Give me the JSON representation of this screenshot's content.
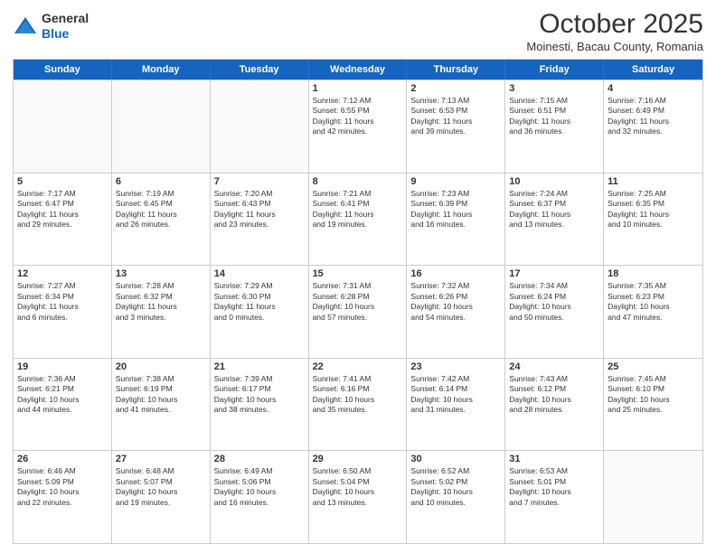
{
  "header": {
    "logo_general": "General",
    "logo_blue": "Blue",
    "month_title": "October 2025",
    "subtitle": "Moinesti, Bacau County, Romania"
  },
  "days_of_week": [
    "Sunday",
    "Monday",
    "Tuesday",
    "Wednesday",
    "Thursday",
    "Friday",
    "Saturday"
  ],
  "weeks": [
    [
      {
        "day": "",
        "info": ""
      },
      {
        "day": "",
        "info": ""
      },
      {
        "day": "",
        "info": ""
      },
      {
        "day": "1",
        "info": "Sunrise: 7:12 AM\nSunset: 6:55 PM\nDaylight: 11 hours\nand 42 minutes."
      },
      {
        "day": "2",
        "info": "Sunrise: 7:13 AM\nSunset: 6:53 PM\nDaylight: 11 hours\nand 39 minutes."
      },
      {
        "day": "3",
        "info": "Sunrise: 7:15 AM\nSunset: 6:51 PM\nDaylight: 11 hours\nand 36 minutes."
      },
      {
        "day": "4",
        "info": "Sunrise: 7:16 AM\nSunset: 6:49 PM\nDaylight: 11 hours\nand 32 minutes."
      }
    ],
    [
      {
        "day": "5",
        "info": "Sunrise: 7:17 AM\nSunset: 6:47 PM\nDaylight: 11 hours\nand 29 minutes."
      },
      {
        "day": "6",
        "info": "Sunrise: 7:19 AM\nSunset: 6:45 PM\nDaylight: 11 hours\nand 26 minutes."
      },
      {
        "day": "7",
        "info": "Sunrise: 7:20 AM\nSunset: 6:43 PM\nDaylight: 11 hours\nand 23 minutes."
      },
      {
        "day": "8",
        "info": "Sunrise: 7:21 AM\nSunset: 6:41 PM\nDaylight: 11 hours\nand 19 minutes."
      },
      {
        "day": "9",
        "info": "Sunrise: 7:23 AM\nSunset: 6:39 PM\nDaylight: 11 hours\nand 16 minutes."
      },
      {
        "day": "10",
        "info": "Sunrise: 7:24 AM\nSunset: 6:37 PM\nDaylight: 11 hours\nand 13 minutes."
      },
      {
        "day": "11",
        "info": "Sunrise: 7:25 AM\nSunset: 6:35 PM\nDaylight: 11 hours\nand 10 minutes."
      }
    ],
    [
      {
        "day": "12",
        "info": "Sunrise: 7:27 AM\nSunset: 6:34 PM\nDaylight: 11 hours\nand 6 minutes."
      },
      {
        "day": "13",
        "info": "Sunrise: 7:28 AM\nSunset: 6:32 PM\nDaylight: 11 hours\nand 3 minutes."
      },
      {
        "day": "14",
        "info": "Sunrise: 7:29 AM\nSunset: 6:30 PM\nDaylight: 11 hours\nand 0 minutes."
      },
      {
        "day": "15",
        "info": "Sunrise: 7:31 AM\nSunset: 6:28 PM\nDaylight: 10 hours\nand 57 minutes."
      },
      {
        "day": "16",
        "info": "Sunrise: 7:32 AM\nSunset: 6:26 PM\nDaylight: 10 hours\nand 54 minutes."
      },
      {
        "day": "17",
        "info": "Sunrise: 7:34 AM\nSunset: 6:24 PM\nDaylight: 10 hours\nand 50 minutes."
      },
      {
        "day": "18",
        "info": "Sunrise: 7:35 AM\nSunset: 6:23 PM\nDaylight: 10 hours\nand 47 minutes."
      }
    ],
    [
      {
        "day": "19",
        "info": "Sunrise: 7:36 AM\nSunset: 6:21 PM\nDaylight: 10 hours\nand 44 minutes."
      },
      {
        "day": "20",
        "info": "Sunrise: 7:38 AM\nSunset: 6:19 PM\nDaylight: 10 hours\nand 41 minutes."
      },
      {
        "day": "21",
        "info": "Sunrise: 7:39 AM\nSunset: 6:17 PM\nDaylight: 10 hours\nand 38 minutes."
      },
      {
        "day": "22",
        "info": "Sunrise: 7:41 AM\nSunset: 6:16 PM\nDaylight: 10 hours\nand 35 minutes."
      },
      {
        "day": "23",
        "info": "Sunrise: 7:42 AM\nSunset: 6:14 PM\nDaylight: 10 hours\nand 31 minutes."
      },
      {
        "day": "24",
        "info": "Sunrise: 7:43 AM\nSunset: 6:12 PM\nDaylight: 10 hours\nand 28 minutes."
      },
      {
        "day": "25",
        "info": "Sunrise: 7:45 AM\nSunset: 6:10 PM\nDaylight: 10 hours\nand 25 minutes."
      }
    ],
    [
      {
        "day": "26",
        "info": "Sunrise: 6:46 AM\nSunset: 5:09 PM\nDaylight: 10 hours\nand 22 minutes."
      },
      {
        "day": "27",
        "info": "Sunrise: 6:48 AM\nSunset: 5:07 PM\nDaylight: 10 hours\nand 19 minutes."
      },
      {
        "day": "28",
        "info": "Sunrise: 6:49 AM\nSunset: 5:06 PM\nDaylight: 10 hours\nand 16 minutes."
      },
      {
        "day": "29",
        "info": "Sunrise: 6:50 AM\nSunset: 5:04 PM\nDaylight: 10 hours\nand 13 minutes."
      },
      {
        "day": "30",
        "info": "Sunrise: 6:52 AM\nSunset: 5:02 PM\nDaylight: 10 hours\nand 10 minutes."
      },
      {
        "day": "31",
        "info": "Sunrise: 6:53 AM\nSunset: 5:01 PM\nDaylight: 10 hours\nand 7 minutes."
      },
      {
        "day": "",
        "info": ""
      }
    ]
  ]
}
